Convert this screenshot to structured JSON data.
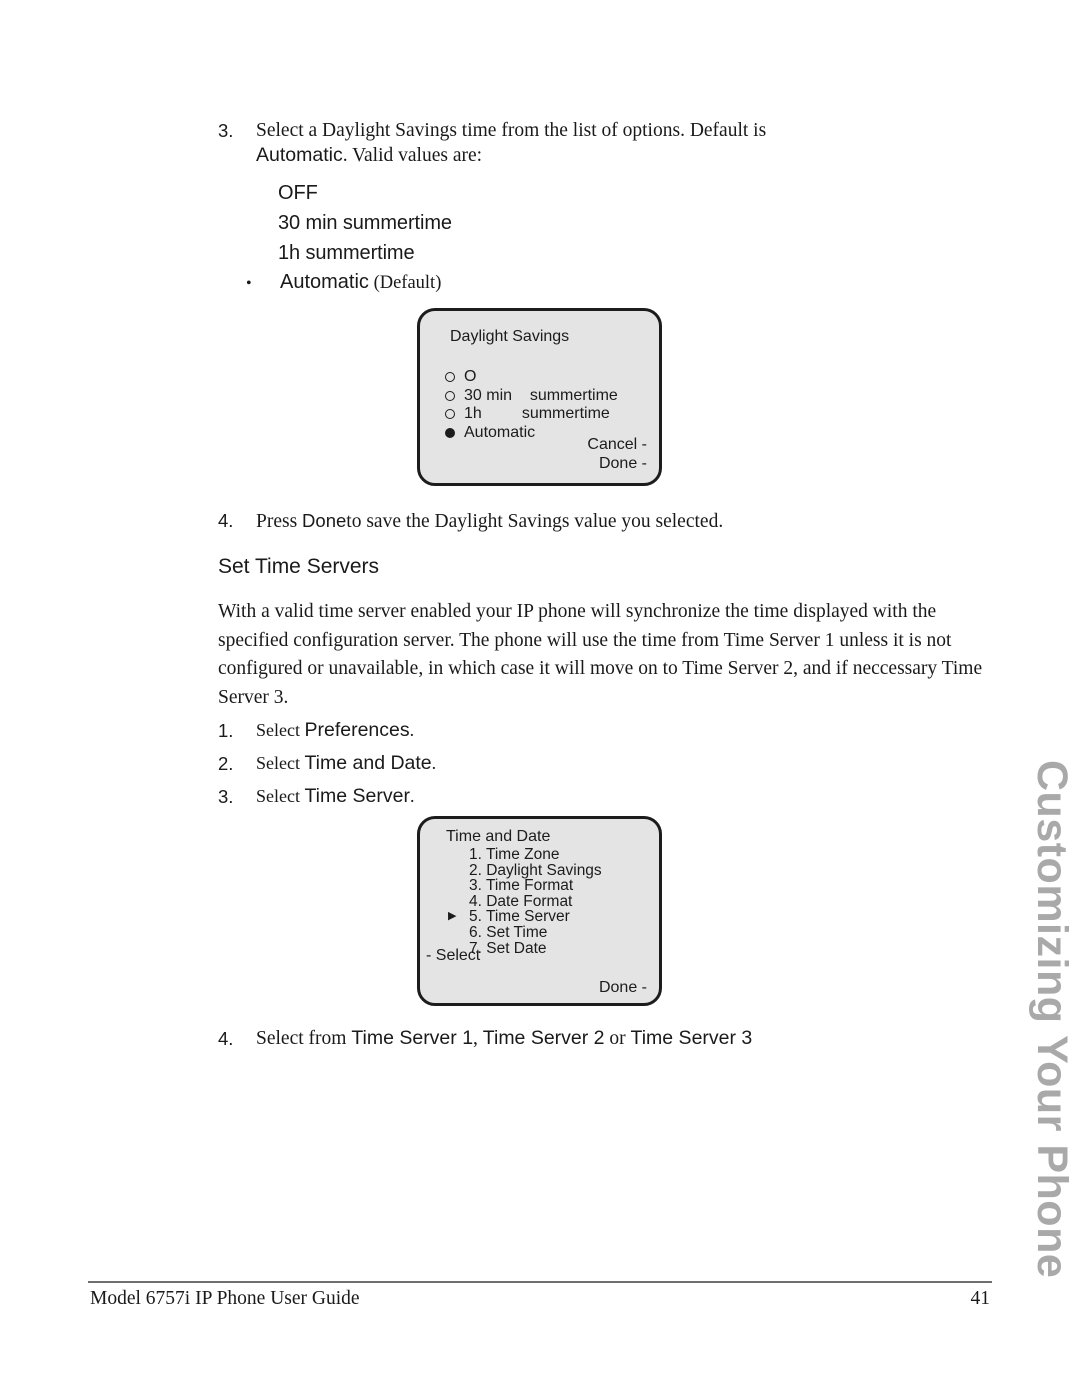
{
  "document": {
    "footer_left": "Model 6757i IP Phone User Guide",
    "footer_page_number": "41",
    "side_tab_label": "Customizing Your Phone"
  },
  "step3": {
    "number": "3.",
    "text_before": "Select a Daylight Savings time from the list of options. Default is ",
    "ui_term": "Automatic",
    "text_after": ". Valid values are:",
    "options": [
      {
        "label": "OFF"
      },
      {
        "label": "30 min summertime"
      },
      {
        "label": "1h summertime"
      }
    ],
    "bullet": {
      "marker": "•",
      "label": "Automatic",
      "suffix": "(Default)"
    }
  },
  "screen_daylight_savings": {
    "title": "Daylight Savings",
    "options": [
      {
        "label": "O",
        "label_col2": "",
        "selected": false
      },
      {
        "label": "30 min",
        "label_col2": "summertime",
        "selected": false
      },
      {
        "label": "1h",
        "label_col2": "summertime",
        "selected": false
      },
      {
        "label": "Automatic",
        "label_col2": "",
        "selected": true
      }
    ],
    "softkeys": [
      {
        "label": "Cancel -"
      },
      {
        "label": "Done -"
      }
    ]
  },
  "step4_daylight": {
    "number": "4.",
    "text_before": "Press ",
    "ui_term": "Done",
    "text_after": "to save the Daylight Savings value you selected."
  },
  "section": {
    "heading": "Set Time Servers",
    "paragraph": "With a valid time server enabled your IP phone will synchronize the time displayed with the specified configuration server. The phone will use the time from Time Server 1 unless it is not configured or unavailable, in which case it will move on to Time Server 2, and if neccessary Time Server 3."
  },
  "steps_time_server": [
    {
      "number": "1.",
      "select_word": "Select ",
      "ui_term": "Preferences",
      "tail": "."
    },
    {
      "number": "2.",
      "select_word": "Select ",
      "ui_term": "Time and Date",
      "tail": "."
    },
    {
      "number": "3.",
      "select_word": "Select ",
      "ui_term": "Time Server",
      "tail": "."
    }
  ],
  "screen_time_and_date": {
    "title": "Time and Date",
    "items": [
      {
        "label": "1. Time Zone",
        "selected": false
      },
      {
        "label": "2. Daylight Savings",
        "selected": false
      },
      {
        "label": "3. Time Format",
        "selected": false
      },
      {
        "label": "4. Date Format",
        "selected": false
      },
      {
        "label": "5. Time Server",
        "selected": true
      },
      {
        "label": "6. Set Time",
        "selected": false
      },
      {
        "label": "7. Set Date",
        "selected": false
      }
    ],
    "select_softkey": "- Select",
    "done_softkey": "Done -"
  },
  "step4_time_server": {
    "number": "4.",
    "text_before": "Select from ",
    "term1": "Time Server 1",
    "sep1": ", ",
    "term2": "Time Server 2",
    "conj": " or ",
    "term3": "Time Server 3"
  },
  "colors": {
    "screen_fill": "#e4e4e4",
    "screen_border": "#1c1c1c",
    "side_tab": "#a9a9a9",
    "footer_rule": "#6f6f6f",
    "text": "#1a1a1a"
  }
}
